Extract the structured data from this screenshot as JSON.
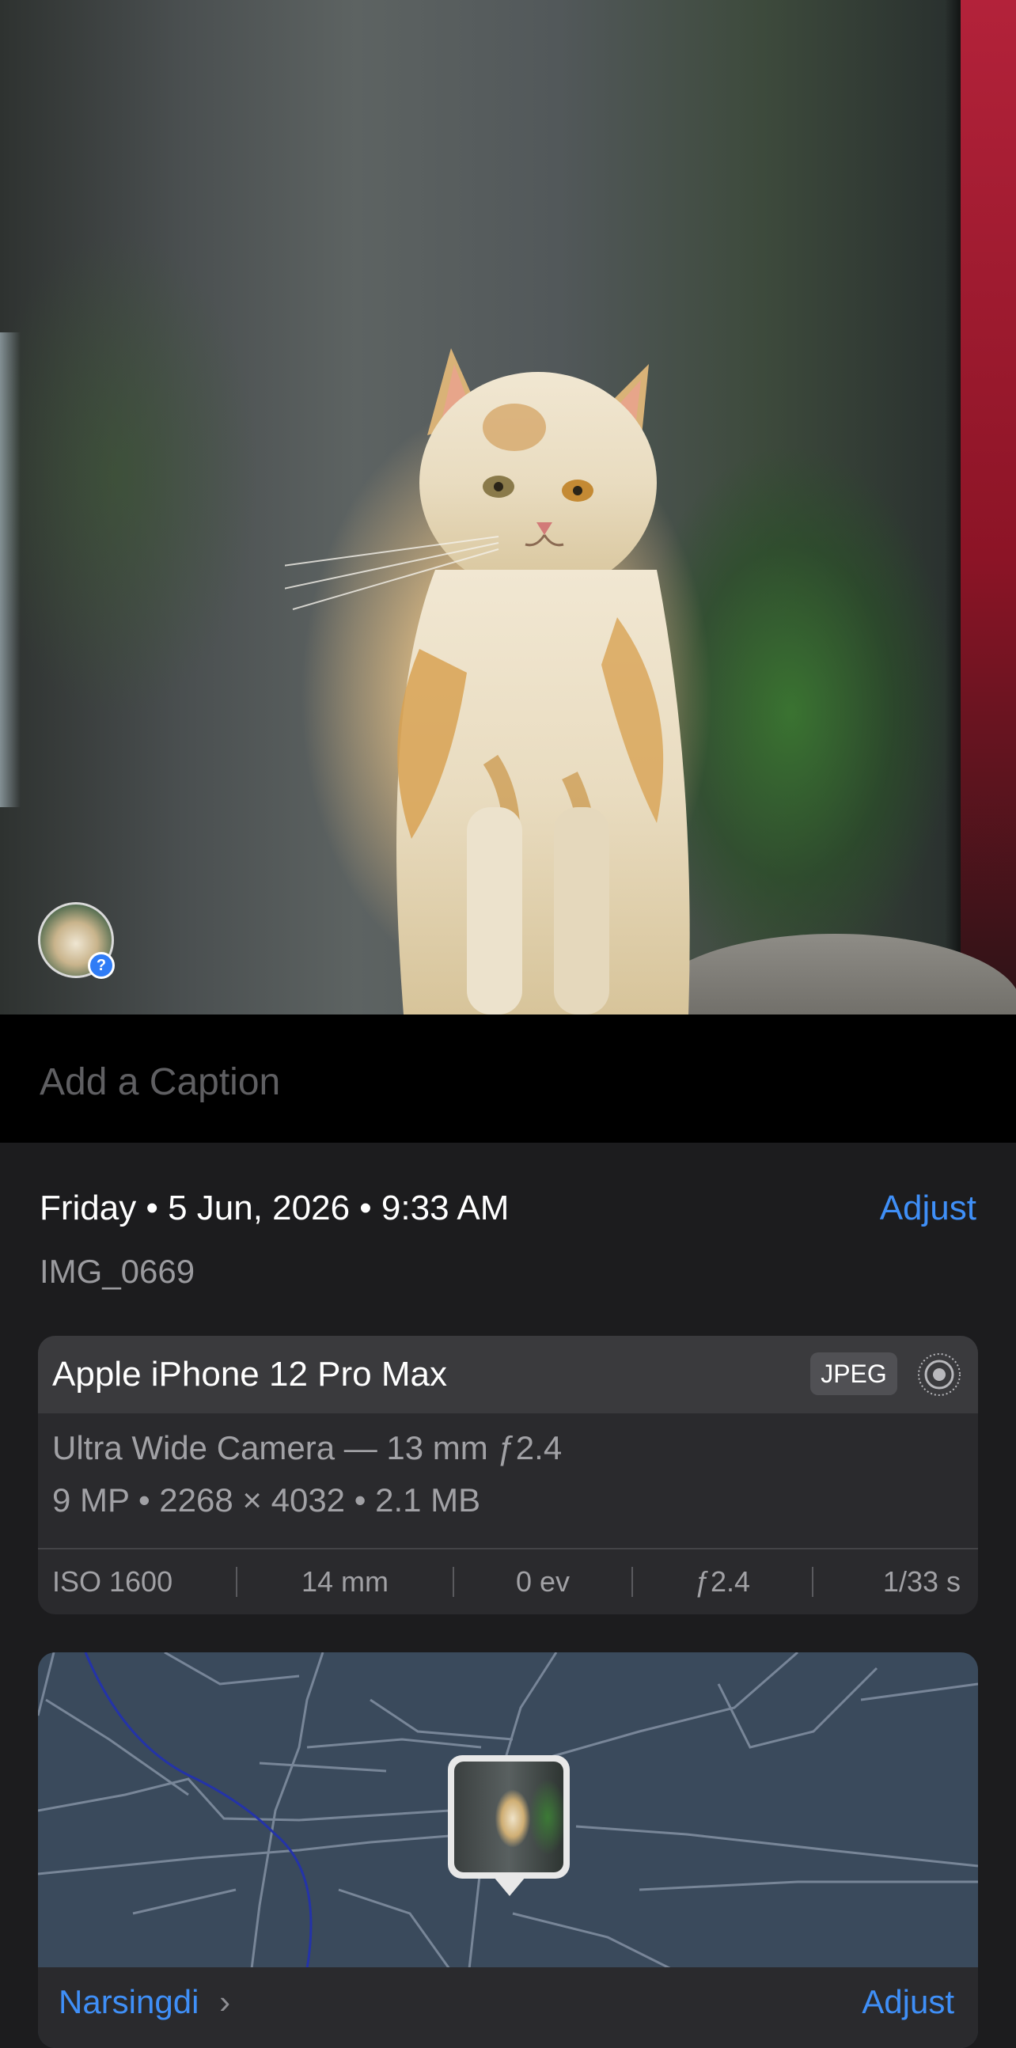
{
  "photo": {
    "subject": "cat-photo"
  },
  "people_badge": {
    "glyph": "?"
  },
  "caption": {
    "placeholder": "Add a Caption"
  },
  "info": {
    "datetime": "Friday • 5 Jun, 2026 • 9:33 AM",
    "adjust_label": "Adjust",
    "filename": "IMG_0669"
  },
  "camera_card": {
    "device": "Apple iPhone 12 Pro Max",
    "format_badge": "JPEG",
    "live_icon": "live-photo-icon",
    "lens": "Ultra Wide Camera — 13 mm ƒ2.4",
    "specs": "9 MP • 2268 × 4032 • 2.1 MB",
    "exif": {
      "iso": "ISO 1600",
      "focal": "14 mm",
      "ev": "0 ev",
      "aperture": "ƒ2.4",
      "shutter": "1/33 s"
    }
  },
  "map": {
    "place": "Narsingdi",
    "chevron": "›",
    "adjust_label": "Adjust"
  },
  "colors": {
    "accent": "#3f8ff7",
    "background": "#1c1c1e",
    "card": "#2a2a2d"
  }
}
